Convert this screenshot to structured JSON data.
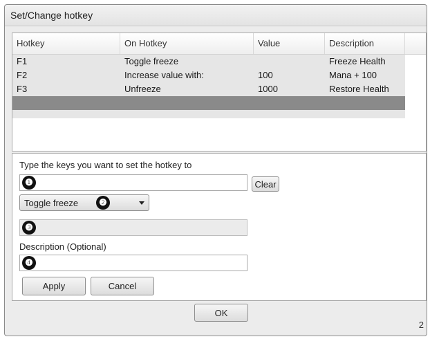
{
  "window": {
    "title": "Set/Change hotkey"
  },
  "grid": {
    "columns": [
      "Hotkey",
      "On Hotkey",
      "Value",
      "Description"
    ],
    "rows": [
      [
        "F1",
        "Toggle freeze",
        "",
        "Freeze Health"
      ],
      [
        "F2",
        "Increase value with:",
        "100",
        "Mana + 100"
      ],
      [
        "F3",
        "Unfreeze",
        "1000",
        "Restore Health"
      ]
    ]
  },
  "panel": {
    "keys_prompt": "Type the keys you want to set the hotkey to",
    "clear_label": "Clear",
    "action_selected": "Toggle freeze",
    "description_label": "Description (Optional)",
    "apply_label": "Apply",
    "cancel_label": "Cancel",
    "markers": [
      "❶",
      "❷",
      "❸",
      "❹"
    ]
  },
  "footer": {
    "ok_label": "OK",
    "page_number": "2"
  },
  "colors": {
    "selected_row": "#8a8a8a",
    "grid_body": "#e6e6e6"
  }
}
